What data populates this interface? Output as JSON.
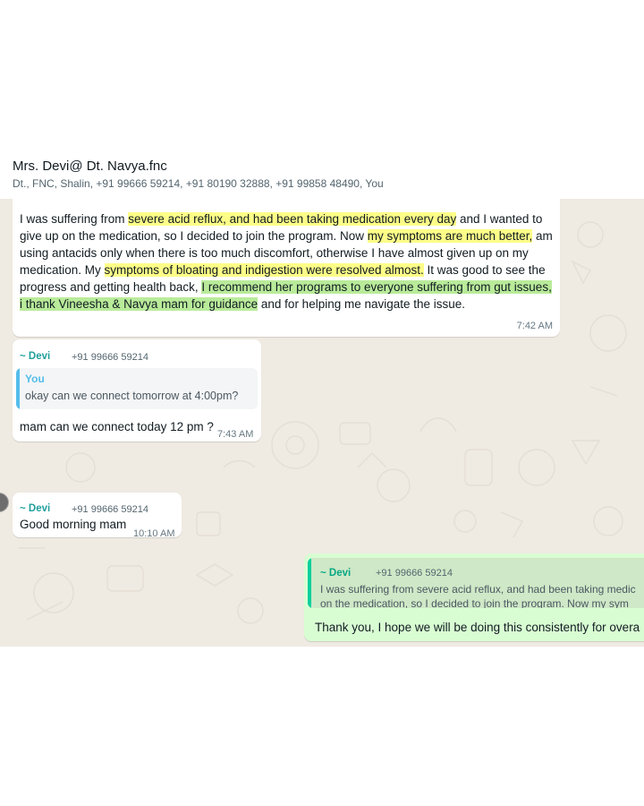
{
  "header": {
    "title": "Mrs. Devi@ Dt. Navya.fnc",
    "participants": "Dt., FNC, Shalin, +91 99666 59214, +91 80190 32888, +91 99858 48490, You"
  },
  "messages": {
    "m1": {
      "segments": [
        {
          "text": "I was suffering from ",
          "hl": "none"
        },
        {
          "text": "severe acid reflux, and had been taking medication every day",
          "hl": "yellow"
        },
        {
          "text": " and I wanted to give up on the medication, so I decided to join the program. Now ",
          "hl": "none"
        },
        {
          "text": "my symptoms are much better,",
          "hl": "yellow"
        },
        {
          "text": " am using antacids only when there is too much discomfort, otherwise I have almost given up on my medication. My ",
          "hl": "none"
        },
        {
          "text": "symptoms of bloating and indigestion were resolved almost.",
          "hl": "yellow"
        },
        {
          "text": " It was good to see the progress and getting health back, ",
          "hl": "none"
        },
        {
          "text": "I recommend her programs to everyone suffering from gut issues, i thank Vineesha & Navya mam for guidance",
          "hl": "green"
        },
        {
          "text": " and for helping me navigate the issue.",
          "hl": "none"
        }
      ],
      "time": "7:42 AM"
    },
    "m2": {
      "sender": "~ Devi",
      "phone": "+91 99666 59214",
      "quote_author": "You",
      "quote_text": "okay can we connect tomorrow at 4:00pm?",
      "text": "mam can we connect today 12 pm ?",
      "time": "7:43 AM"
    },
    "m3": {
      "sender": "~ Devi",
      "phone": "+91 99666 59214",
      "text": "Good morning mam",
      "time": "10:10 AM"
    },
    "m4": {
      "quote_sender": "~ Devi",
      "quote_phone": "+91 99666 59214",
      "quote_line1": "I was suffering from severe acid reflux, and had been taking medic",
      "quote_line2": "on the medication, so I decided to join the program. Now my sym",
      "text": "Thank you, I hope we will be doing this consistently for overa"
    }
  },
  "colors": {
    "chat_bg": "#efeae2",
    "incoming": "#ffffff",
    "outgoing": "#d9fdd3",
    "highlight_yellow": "#fdfd88",
    "highlight_green": "#b9eb9a",
    "sender_name": "#1fa09b"
  }
}
